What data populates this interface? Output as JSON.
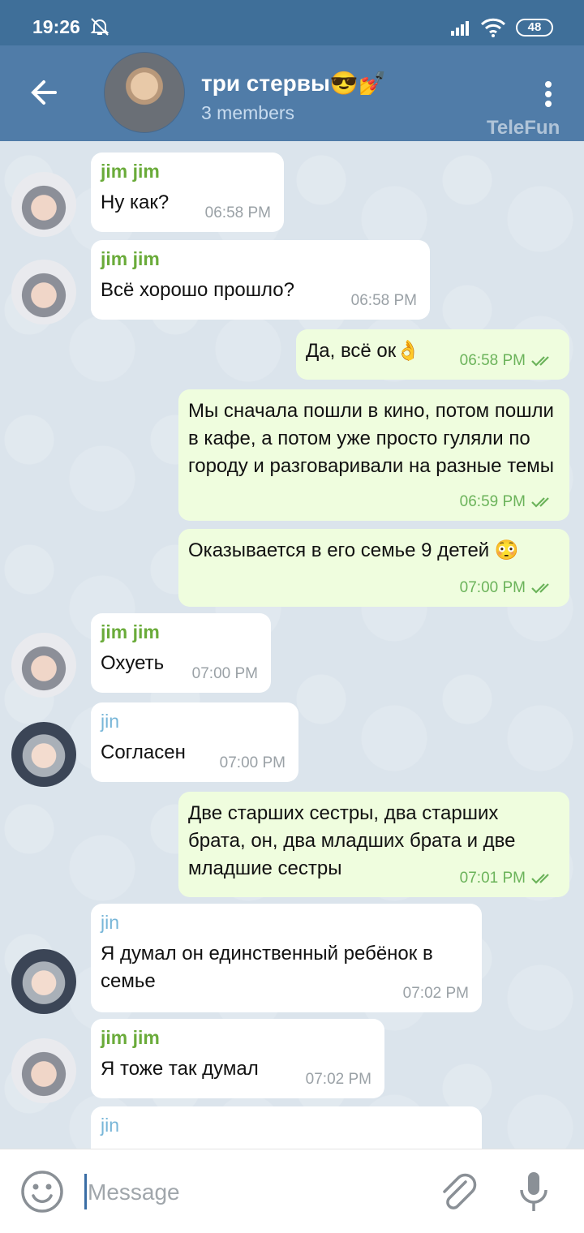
{
  "status": {
    "time": "19:26",
    "battery": "48"
  },
  "header": {
    "title": "три стервы😎💅",
    "subtitle": "3 members",
    "watermark": "TeleFun"
  },
  "messages": [
    {
      "sender": "jim jim",
      "text": "Ну как?",
      "time": "06:58 PM",
      "direction": "in"
    },
    {
      "sender": "jim jim",
      "text": "Всё хорошо прошло?",
      "time": "06:58 PM",
      "direction": "in"
    },
    {
      "text": "Да, всё ок👌",
      "time": "06:58 PM",
      "direction": "out"
    },
    {
      "text": "Мы сначала пошли в кино, потом пошли в кафе, а потом уже просто гуляли по городу и разговаривали на разные темы",
      "time": "06:59 PM",
      "direction": "out"
    },
    {
      "text": "Оказывается в его семье 9 детей 😳",
      "time": "07:00 PM",
      "direction": "out"
    },
    {
      "sender": "jim jim",
      "text": "Охуеть",
      "time": "07:00 PM",
      "direction": "in"
    },
    {
      "sender": "jin",
      "text": "Согласен",
      "time": "07:00 PM",
      "direction": "in"
    },
    {
      "text": "Две старших сестры, два старших брата, он, два младших брата и две младшие сестры",
      "time": "07:01 PM",
      "direction": "out"
    },
    {
      "sender": "jin",
      "text": "Я думал он единственный ребёнок в семье",
      "time": "07:02 PM",
      "direction": "in"
    },
    {
      "sender": "jim jim",
      "text": "Я тоже так думал",
      "time": "07:02 PM",
      "direction": "in"
    },
    {
      "sender": "jin",
      "text": "",
      "time": "",
      "direction": "in"
    }
  ],
  "composer": {
    "placeholder": "Message"
  },
  "colors": {
    "header": "#507ca8",
    "statusbar": "#3f6f99",
    "outgoing": "#effdde",
    "incoming": "#ffffff",
    "name_jim": "#6aab3a",
    "name_jin": "#78b6d8"
  }
}
